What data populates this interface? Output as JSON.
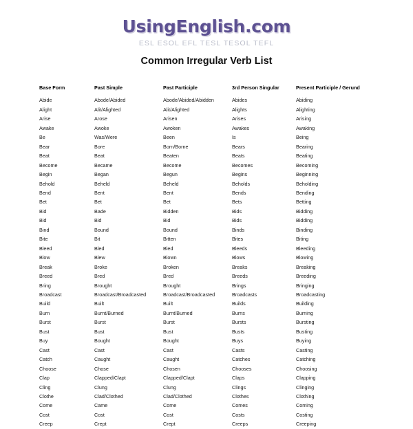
{
  "brand": {
    "logo": "UsingEnglish.com",
    "tagline": "ESL ESOL EFL TESL TESOL TEFL",
    "logo_color": "#5d5192",
    "tagline_color": "#b9bcc9"
  },
  "page": {
    "title": "Common Irregular Verb List",
    "background_color": "#ffffff",
    "text_color": "#1a1a1a"
  },
  "table": {
    "headers": [
      "Base Form",
      "Past Simple",
      "Past Participle",
      "3rd Person Singular",
      "Present Participle / Gerund"
    ],
    "rows": [
      [
        "Abide",
        "Abode/Abided",
        "Abode/Abided/Abidden",
        "Abides",
        "Abiding"
      ],
      [
        "Alight",
        "Alit/Alighted",
        "Alit/Alighted",
        "Alights",
        "Alighting"
      ],
      [
        "Arise",
        "Arose",
        "Arisen",
        "Arises",
        "Arising"
      ],
      [
        "Awake",
        "Awoke",
        "Awoken",
        "Awakes",
        "Awaking"
      ],
      [
        "Be",
        "Was/Were",
        "Been",
        "Is",
        "Being"
      ],
      [
        "Bear",
        "Bore",
        "Born/Borne",
        "Bears",
        "Bearing"
      ],
      [
        "Beat",
        "Beat",
        "Beaten",
        "Beats",
        "Beating"
      ],
      [
        "Become",
        "Became",
        "Become",
        "Becomes",
        "Becoming"
      ],
      [
        "Begin",
        "Began",
        "Begun",
        "Begins",
        "Beginning"
      ],
      [
        "Behold",
        "Beheld",
        "Beheld",
        "Beholds",
        "Beholding"
      ],
      [
        "Bend",
        "Bent",
        "Bent",
        "Bends",
        "Bending"
      ],
      [
        "Bet",
        "Bet",
        "Bet",
        "Bets",
        "Betting"
      ],
      [
        "Bid",
        "Bade",
        "Bidden",
        "Bids",
        "Bidding"
      ],
      [
        "Bid",
        "Bid",
        "Bid",
        "Bids",
        "Bidding"
      ],
      [
        "Bind",
        "Bound",
        "Bound",
        "Binds",
        "Binding"
      ],
      [
        "Bite",
        "Bit",
        "Bitten",
        "Bites",
        "Biting"
      ],
      [
        "Bleed",
        "Bled",
        "Bled",
        "Bleeds",
        "Bleeding"
      ],
      [
        "Blow",
        "Blew",
        "Blown",
        "Blows",
        "Blowing"
      ],
      [
        "Break",
        "Broke",
        "Broken",
        "Breaks",
        "Breaking"
      ],
      [
        "Breed",
        "Bred",
        "Bred",
        "Breeds",
        "Breeding"
      ],
      [
        "Bring",
        "Brought",
        "Brought",
        "Brings",
        "Bringing"
      ],
      [
        "Broadcast",
        "Broadcast/Broadcasted",
        "Broadcast/Broadcasted",
        "Broadcasts",
        "Broadcasting"
      ],
      [
        "Build",
        "Built",
        "Built",
        "Builds",
        "Building"
      ],
      [
        "Burn",
        "Burnt/Burned",
        "Burnt/Burned",
        "Burns",
        "Burning"
      ],
      [
        "Burst",
        "Burst",
        "Burst",
        "Bursts",
        "Bursting"
      ],
      [
        "Bust",
        "Bust",
        "Bust",
        "Busts",
        "Busting"
      ],
      [
        "Buy",
        "Bought",
        "Bought",
        "Buys",
        "Buying"
      ],
      [
        "Cast",
        "Cast",
        "Cast",
        "Casts",
        "Casting"
      ],
      [
        "Catch",
        "Caught",
        "Caught",
        "Catches",
        "Catching"
      ],
      [
        "Choose",
        "Chose",
        "Chosen",
        "Chooses",
        "Choosing"
      ],
      [
        "Clap",
        "Clapped/Clapt",
        "Clapped/Clapt",
        "Claps",
        "Clapping"
      ],
      [
        "Cling",
        "Clung",
        "Clung",
        "Clings",
        "Clinging"
      ],
      [
        "Clothe",
        "Clad/Clothed",
        "Clad/Clothed",
        "Clothes",
        "Clothing"
      ],
      [
        "Come",
        "Came",
        "Come",
        "Comes",
        "Coming"
      ],
      [
        "Cost",
        "Cost",
        "Cost",
        "Costs",
        "Costing"
      ],
      [
        "Creep",
        "Crept",
        "Crept",
        "Creeps",
        "Creeping"
      ]
    ]
  }
}
